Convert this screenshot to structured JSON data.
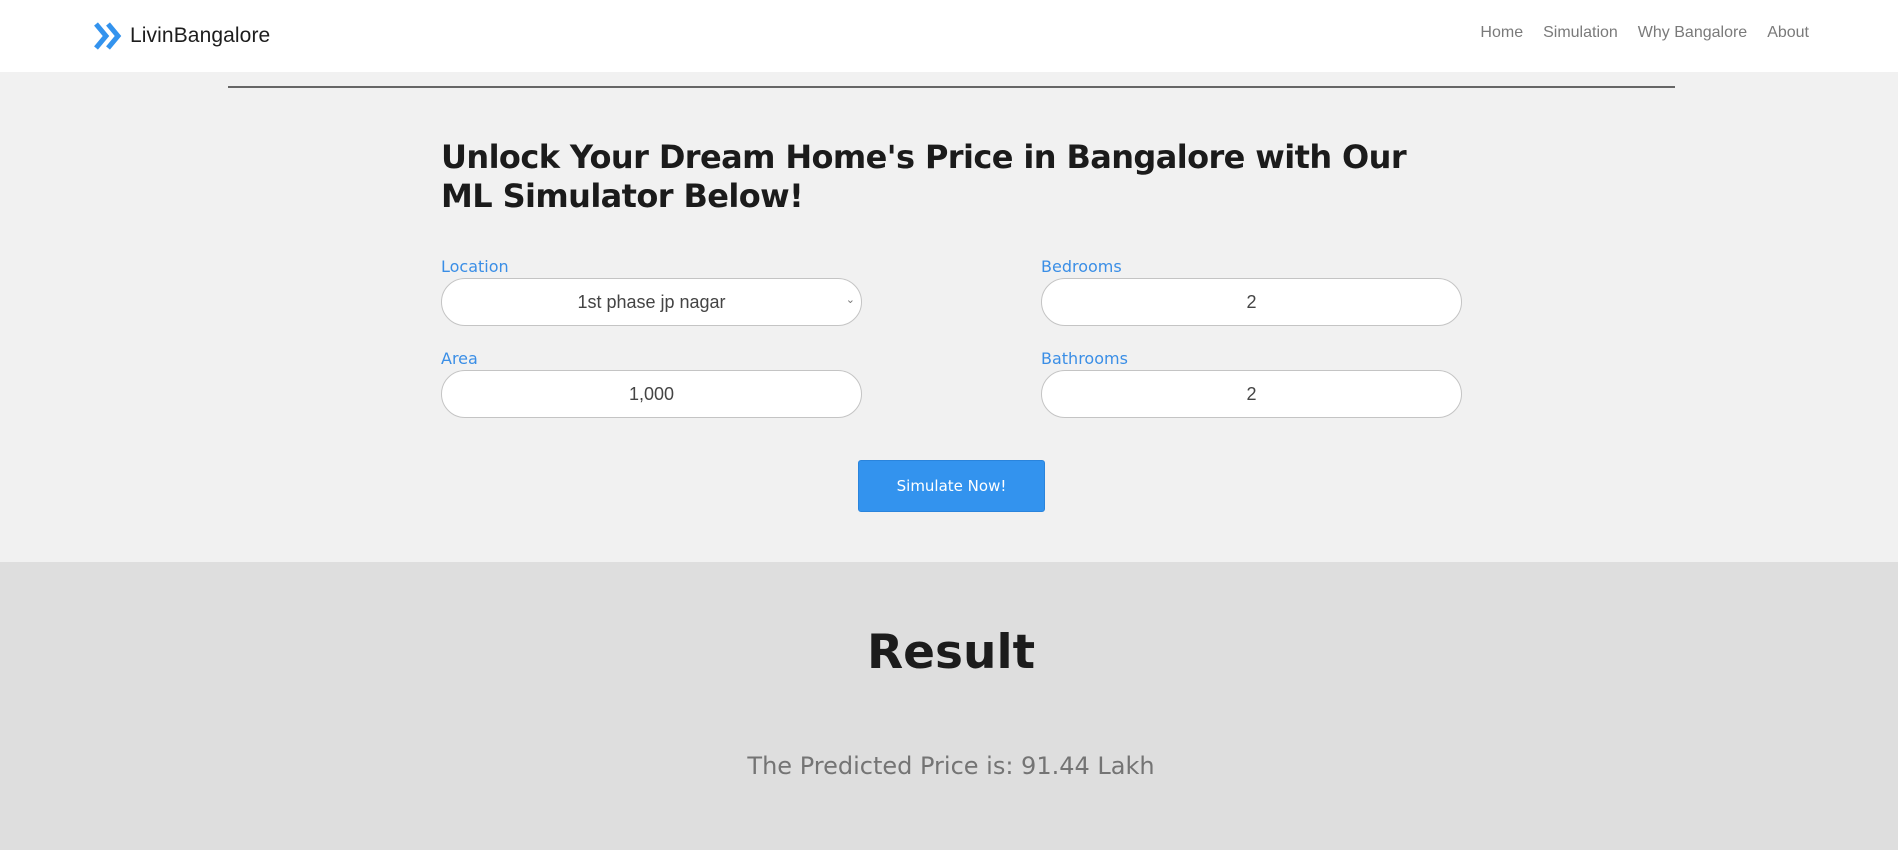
{
  "navbar": {
    "brand": "LivinBangalore",
    "links": [
      "Home",
      "Simulation",
      "Why Bangalore",
      "About"
    ]
  },
  "simulator": {
    "headline": "Unlock Your Dream Home's Price in Bangalore with Our ML Simulator Below!",
    "location": {
      "label": "Location",
      "value": "1st phase jp nagar"
    },
    "bedrooms": {
      "label": "Bedrooms",
      "value": "2"
    },
    "area": {
      "label": "Area",
      "value": "1,000"
    },
    "bathrooms": {
      "label": "Bathrooms",
      "value": "2"
    },
    "button": "Simulate Now!"
  },
  "result": {
    "title": "Result",
    "text": "The Predicted Price is: 91.44 Lakh"
  },
  "colors": {
    "accent": "#3393ee",
    "label": "#3a8ee6",
    "section_light": "#f1f1f1",
    "section_dark": "#dedede"
  },
  "icons": {
    "brand": "double-chevron-right-icon",
    "select": "chevron-down-icon"
  }
}
